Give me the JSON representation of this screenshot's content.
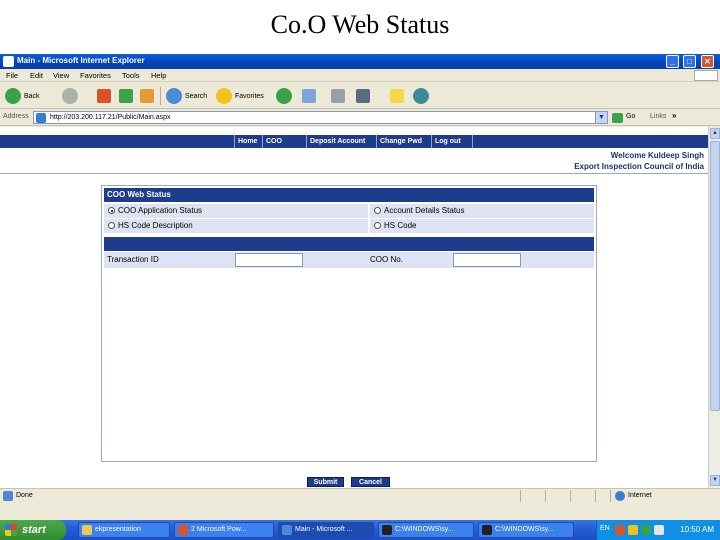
{
  "slide": {
    "title": "Co.O Web Status"
  },
  "window": {
    "title": "Main - Microsoft Internet Explorer",
    "controls": {
      "minimize": "_",
      "maximize": "□",
      "close": "✕"
    }
  },
  "menu": [
    "File",
    "Edit",
    "View",
    "Favorites",
    "Tools",
    "Help"
  ],
  "toolbar": {
    "back": "Back",
    "search": "Search",
    "favorites": "Favorites"
  },
  "address": {
    "label": "Address",
    "url": "http://203.200.117.21/Public/Main.aspx",
    "go": "Go",
    "links": "Links",
    "more": "»"
  },
  "nav": [
    "Home",
    "COO",
    "Deposit Account",
    "Change Pwd",
    "Log out"
  ],
  "header": {
    "welcome": "Welcome Kuldeep Singh",
    "organization": "Export Inspection Council of India"
  },
  "panel": {
    "title": "COO Web Status",
    "options": [
      {
        "label": "COO Application Status",
        "selected": true
      },
      {
        "label": "Account Details Status",
        "selected": false
      },
      {
        "label": "HS Code Description",
        "selected": false
      },
      {
        "label": "HS Code",
        "selected": false
      }
    ],
    "fields": {
      "transaction_label": "Transaction ID",
      "transaction_value": "",
      "coo_label": "COO No.",
      "coo_value": ""
    }
  },
  "buttons": {
    "submit": "Submit",
    "cancel": "Cancel"
  },
  "status": {
    "text": "Done",
    "zone": "Internet"
  },
  "taskbar": {
    "start": "start",
    "tasks": [
      "ekpresentation",
      "2 Microsoft Pow...",
      "Main - Microsoft ...",
      "C:\\WINDOWS\\sy...",
      "C:\\WINDOWS\\sy..."
    ],
    "lang": "EN",
    "clock": "10:50 AM"
  },
  "colors": {
    "brand_navy": "#1e3c8c",
    "row_fill": "#dde3f2",
    "xp_blue": "#245ed6"
  }
}
